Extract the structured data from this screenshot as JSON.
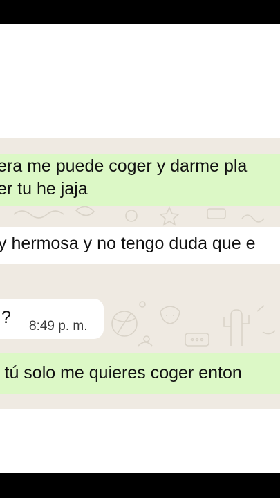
{
  "chat": {
    "messages": [
      {
        "direction": "outgoing",
        "lines": [
          "era me puede coger y darme pla",
          "er tu he jaja"
        ]
      },
      {
        "direction": "incoming",
        "lines": [
          "y hermosa y no tengo duda que e"
        ]
      },
      {
        "direction": "incoming",
        "text": "?",
        "time": "8:49 p. m."
      },
      {
        "direction": "outgoing",
        "lines": [
          "i tú solo me quieres coger enton"
        ]
      }
    ]
  },
  "colors": {
    "outgoing_bubble": "#dcf8c6",
    "incoming_bubble": "#ffffff",
    "chat_background": "#efeae2",
    "letterbox": "#000000"
  }
}
